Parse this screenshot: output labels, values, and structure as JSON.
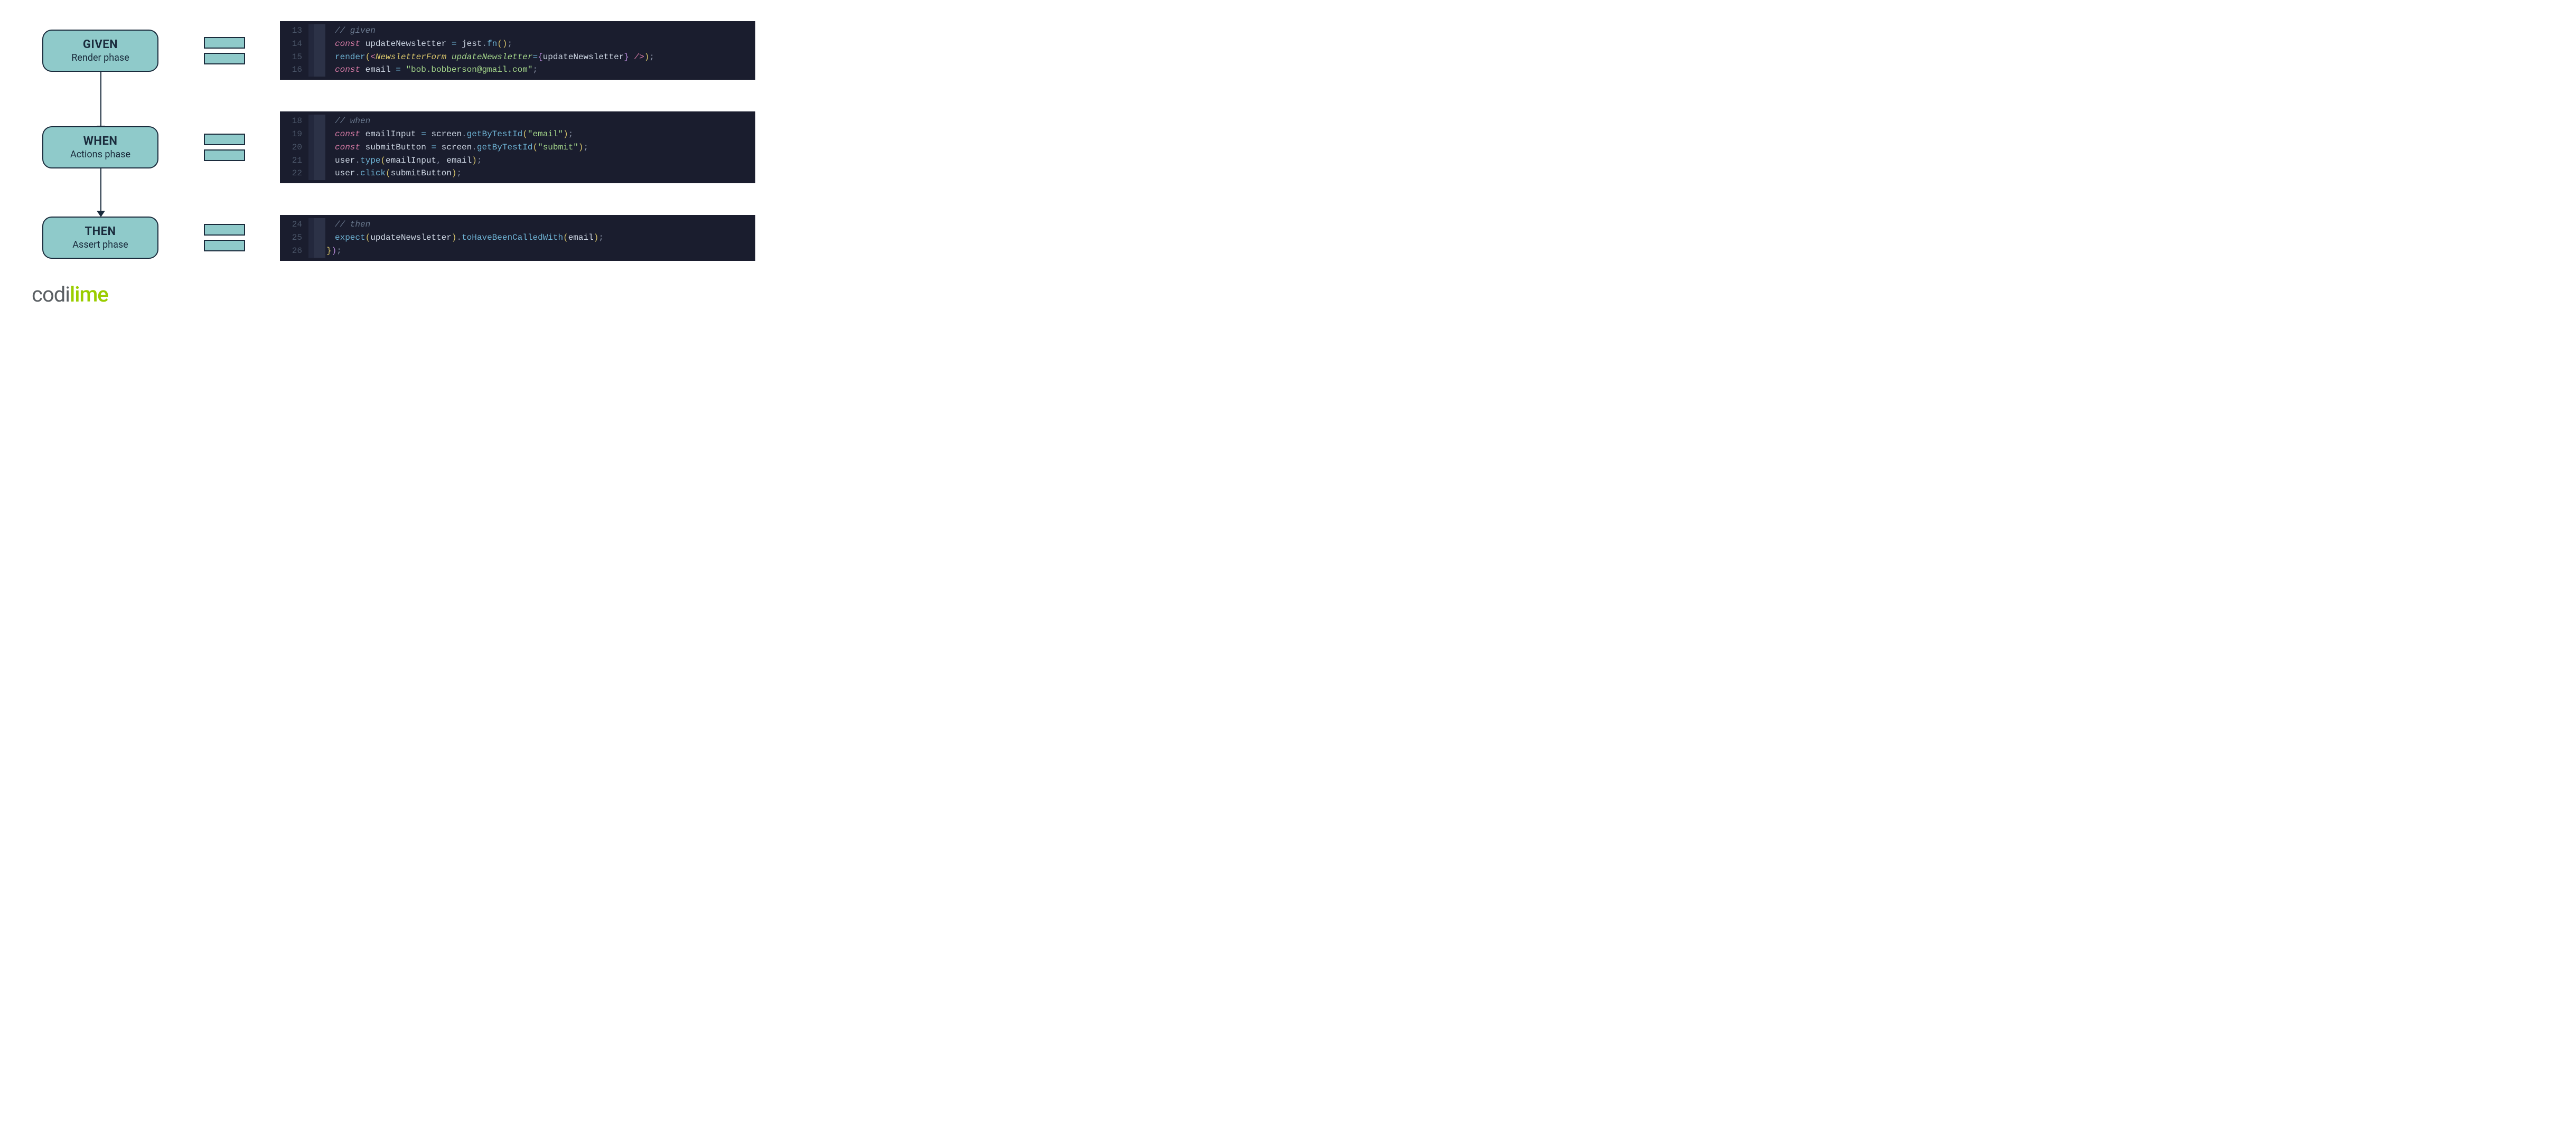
{
  "phases": [
    {
      "title": "GIVEN",
      "subtitle": "Render phase"
    },
    {
      "title": "WHEN",
      "subtitle": "Actions phase"
    },
    {
      "title": "THEN",
      "subtitle": "Assert phase"
    }
  ],
  "code": {
    "given": [
      {
        "n": "13",
        "tokens": [
          {
            "t": "// given",
            "c": "tk-comment"
          }
        ]
      },
      {
        "n": "14",
        "tokens": [
          {
            "t": "const ",
            "c": "tk-keyword"
          },
          {
            "t": "updateNewsletter ",
            "c": "tk-ident"
          },
          {
            "t": "= ",
            "c": "tk-op"
          },
          {
            "t": "jest",
            "c": "tk-obj"
          },
          {
            "t": ".",
            "c": "tk-punct"
          },
          {
            "t": "fn",
            "c": "tk-func"
          },
          {
            "t": "()",
            "c": "tk-paren"
          },
          {
            "t": ";",
            "c": "tk-punct"
          }
        ]
      },
      {
        "n": "15",
        "tokens": [
          {
            "t": "render",
            "c": "tk-func"
          },
          {
            "t": "(",
            "c": "tk-paren"
          },
          {
            "t": "<",
            "c": "tk-tag"
          },
          {
            "t": "NewsletterForm ",
            "c": "tk-comp"
          },
          {
            "t": "updateNewsletter",
            "c": "tk-attr"
          },
          {
            "t": "=",
            "c": "tk-op"
          },
          {
            "t": "{",
            "c": "tk-paren2"
          },
          {
            "t": "updateNewsletter",
            "c": "tk-ident"
          },
          {
            "t": "}",
            "c": "tk-paren2"
          },
          {
            "t": " />",
            "c": "tk-tag"
          },
          {
            "t": ")",
            "c": "tk-paren"
          },
          {
            "t": ";",
            "c": "tk-punct"
          }
        ]
      },
      {
        "n": "16",
        "tokens": [
          {
            "t": "const ",
            "c": "tk-keyword"
          },
          {
            "t": "email ",
            "c": "tk-ident"
          },
          {
            "t": "= ",
            "c": "tk-op"
          },
          {
            "t": "\"bob.bobberson@gmail.com\"",
            "c": "tk-str"
          },
          {
            "t": ";",
            "c": "tk-punct"
          }
        ]
      }
    ],
    "when": [
      {
        "n": "18",
        "tokens": [
          {
            "t": "// when",
            "c": "tk-comment"
          }
        ]
      },
      {
        "n": "19",
        "tokens": [
          {
            "t": "const ",
            "c": "tk-keyword"
          },
          {
            "t": "emailInput ",
            "c": "tk-ident"
          },
          {
            "t": "= ",
            "c": "tk-op"
          },
          {
            "t": "screen",
            "c": "tk-obj"
          },
          {
            "t": ".",
            "c": "tk-punct"
          },
          {
            "t": "getByTestId",
            "c": "tk-func"
          },
          {
            "t": "(",
            "c": "tk-paren"
          },
          {
            "t": "\"email\"",
            "c": "tk-str"
          },
          {
            "t": ")",
            "c": "tk-paren"
          },
          {
            "t": ";",
            "c": "tk-punct"
          }
        ]
      },
      {
        "n": "20",
        "tokens": [
          {
            "t": "const ",
            "c": "tk-keyword"
          },
          {
            "t": "submitButton ",
            "c": "tk-ident"
          },
          {
            "t": "= ",
            "c": "tk-op"
          },
          {
            "t": "screen",
            "c": "tk-obj"
          },
          {
            "t": ".",
            "c": "tk-punct"
          },
          {
            "t": "getByTestId",
            "c": "tk-func"
          },
          {
            "t": "(",
            "c": "tk-paren"
          },
          {
            "t": "\"submit\"",
            "c": "tk-str"
          },
          {
            "t": ")",
            "c": "tk-paren"
          },
          {
            "t": ";",
            "c": "tk-punct"
          }
        ]
      },
      {
        "n": "21",
        "tokens": [
          {
            "t": "user",
            "c": "tk-obj"
          },
          {
            "t": ".",
            "c": "tk-punct"
          },
          {
            "t": "type",
            "c": "tk-func"
          },
          {
            "t": "(",
            "c": "tk-paren"
          },
          {
            "t": "emailInput",
            "c": "tk-ident"
          },
          {
            "t": ", ",
            "c": "tk-punct"
          },
          {
            "t": "email",
            "c": "tk-ident"
          },
          {
            "t": ")",
            "c": "tk-paren"
          },
          {
            "t": ";",
            "c": "tk-punct"
          }
        ]
      },
      {
        "n": "22",
        "tokens": [
          {
            "t": "user",
            "c": "tk-obj"
          },
          {
            "t": ".",
            "c": "tk-punct"
          },
          {
            "t": "click",
            "c": "tk-func"
          },
          {
            "t": "(",
            "c": "tk-paren"
          },
          {
            "t": "submitButton",
            "c": "tk-ident"
          },
          {
            "t": ")",
            "c": "tk-paren"
          },
          {
            "t": ";",
            "c": "tk-punct"
          }
        ]
      }
    ],
    "then": [
      {
        "n": "24",
        "tokens": [
          {
            "t": "// then",
            "c": "tk-comment"
          }
        ]
      },
      {
        "n": "25",
        "tokens": [
          {
            "t": "expect",
            "c": "tk-func"
          },
          {
            "t": "(",
            "c": "tk-paren"
          },
          {
            "t": "updateNewsletter",
            "c": "tk-ident"
          },
          {
            "t": ")",
            "c": "tk-paren"
          },
          {
            "t": ".",
            "c": "tk-punct"
          },
          {
            "t": "toHaveBeenCalledWith",
            "c": "tk-func"
          },
          {
            "t": "(",
            "c": "tk-paren"
          },
          {
            "t": "email",
            "c": "tk-ident"
          },
          {
            "t": ")",
            "c": "tk-paren"
          },
          {
            "t": ";",
            "c": "tk-punct"
          }
        ]
      },
      {
        "n": "26",
        "indent": -1,
        "tokens": [
          {
            "t": "}",
            "c": "tk-brace2"
          },
          {
            "t": ")",
            "c": "tk-paren2"
          },
          {
            "t": ";",
            "c": "tk-punct"
          }
        ]
      }
    ]
  },
  "logo": {
    "part1": "codi",
    "part2": "lime"
  }
}
